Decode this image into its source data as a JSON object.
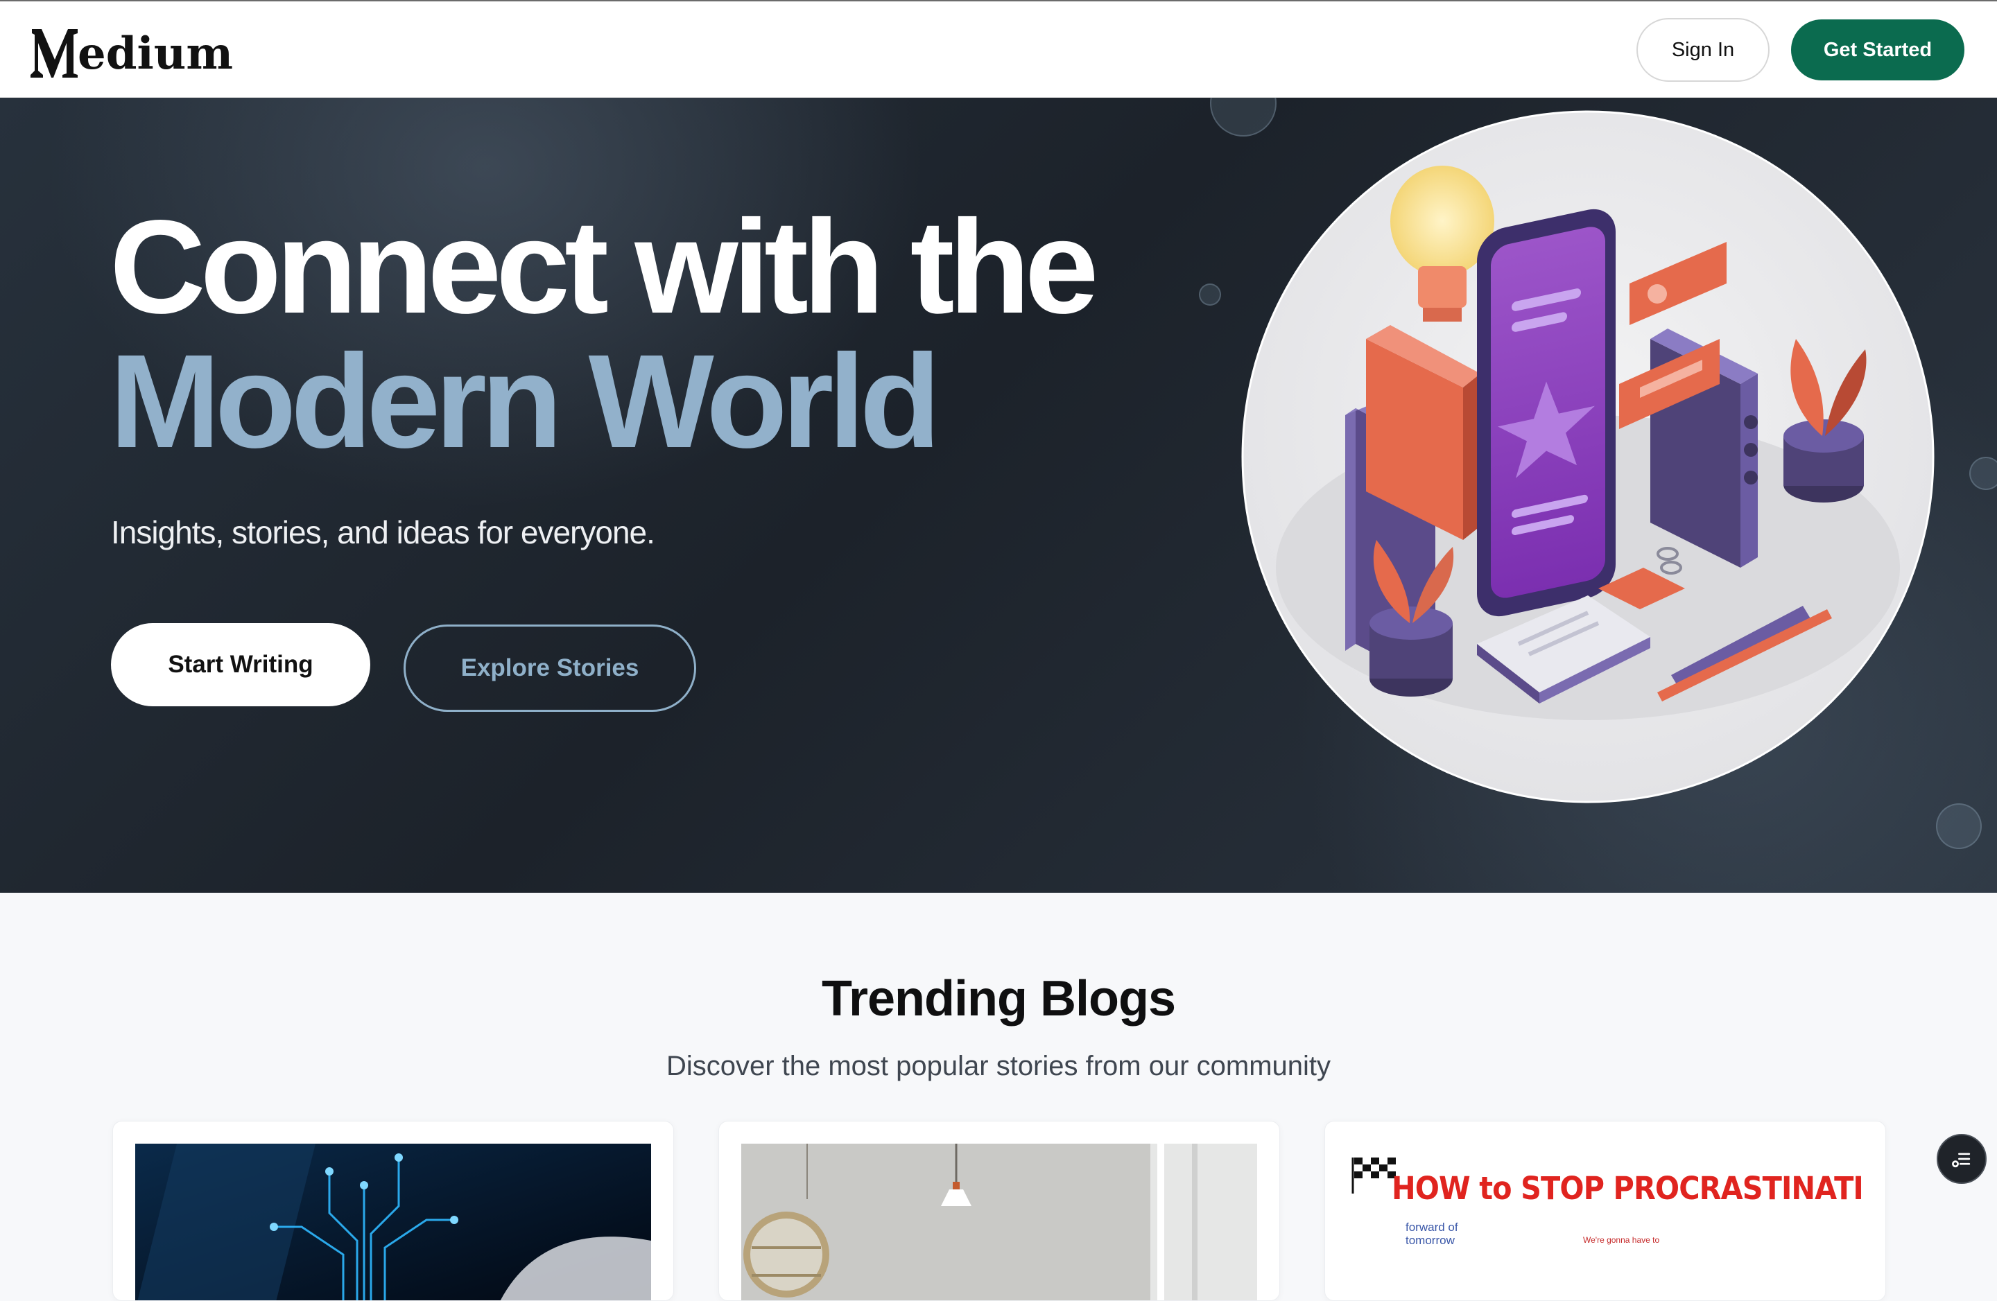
{
  "header": {
    "logo_text": "edium",
    "sign_in": "Sign In",
    "get_started": "Get Started"
  },
  "hero": {
    "title_line1": "Connect with the",
    "title_line2": "Modern World",
    "subtitle": "Insights, stories, and ideas for everyone.",
    "start_writing": "Start Writing",
    "explore_stories": "Explore Stories"
  },
  "trending": {
    "title": "Trending Blogs",
    "subtitle": "Discover the most popular stories from our community",
    "cards": [
      {
        "image": "circuit-chip-hand-image"
      },
      {
        "image": "interior-lamp-shelf-image"
      },
      {
        "image": "procrastination-comic-image",
        "headline": "HOW to STOP PROCRASTINATING",
        "caption_left": "forward of tomorrow",
        "caption_right": "We're gonna have to"
      }
    ]
  },
  "colors": {
    "brand_green": "#0b6b4f",
    "hero_accent": "#92b1cb",
    "hero_bg": "#1f262e"
  },
  "icons": {
    "fab": "list-settings-icon"
  }
}
